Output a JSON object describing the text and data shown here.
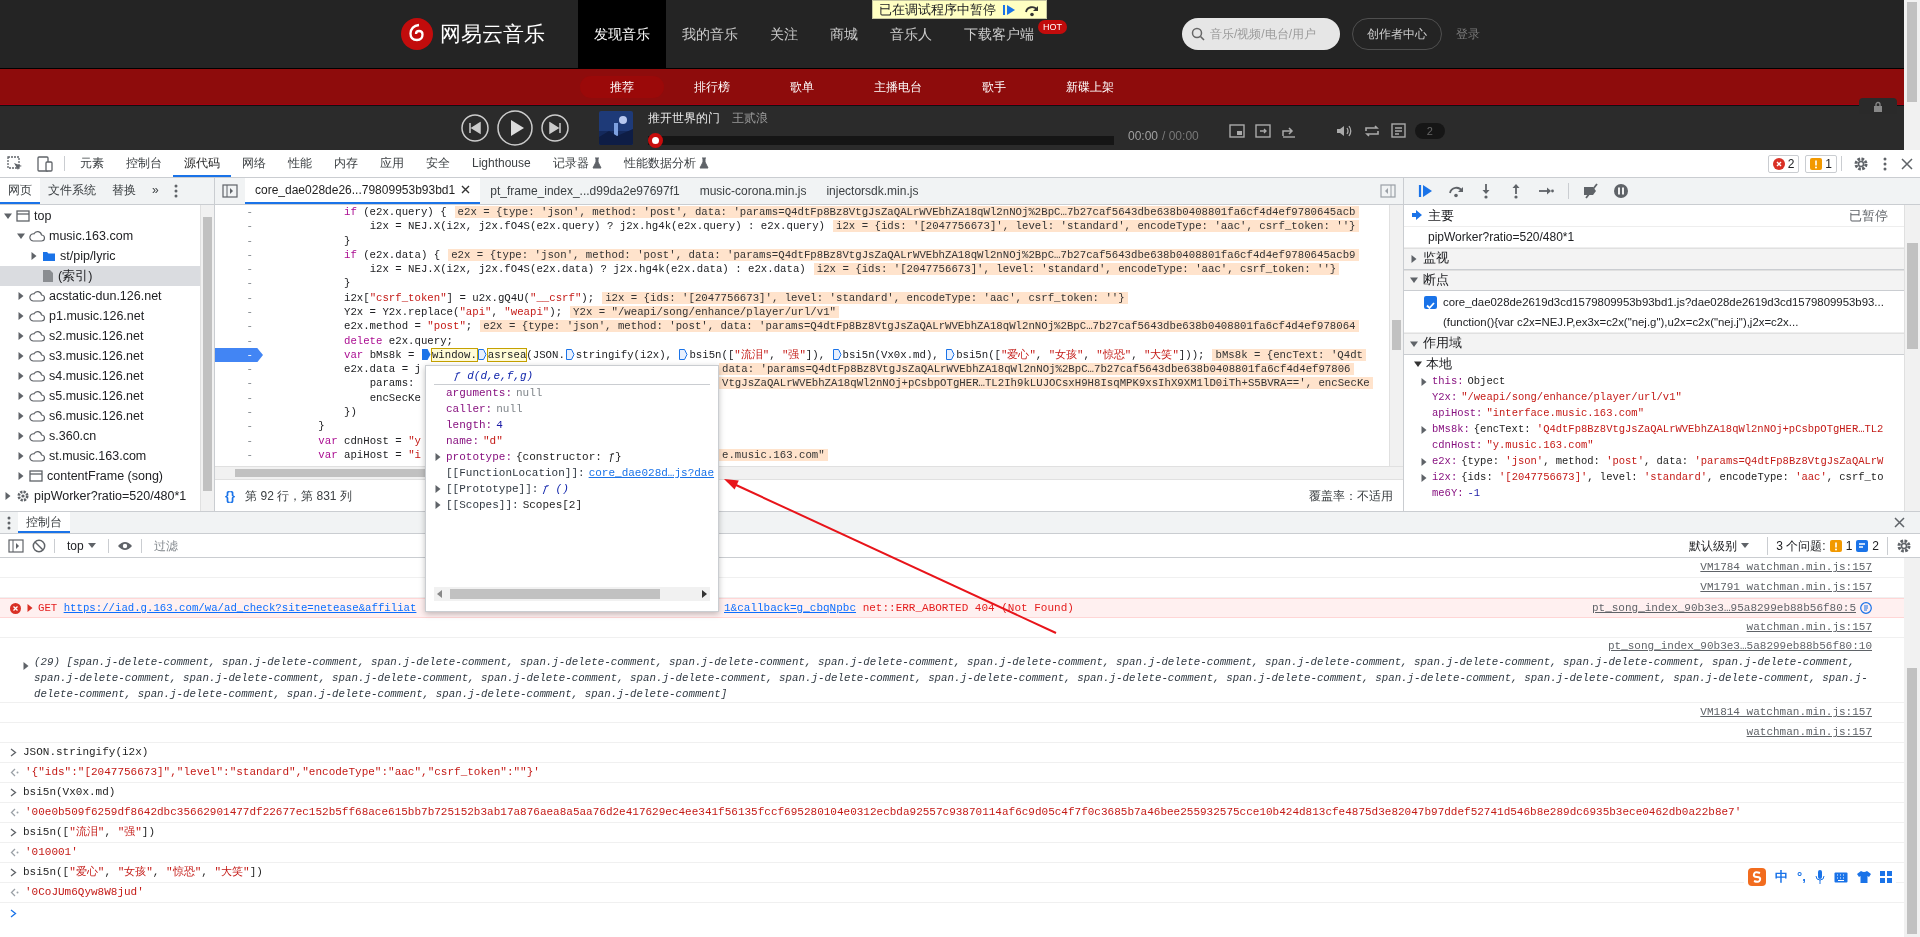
{
  "site": {
    "logo": "网易云音乐",
    "nav": [
      {
        "label": "发现音乐",
        "selected": true
      },
      {
        "label": "我的音乐",
        "selected": false
      },
      {
        "label": "关注",
        "selected": false
      },
      {
        "label": "商城",
        "selected": false
      },
      {
        "label": "音乐人",
        "selected": false
      },
      {
        "label": "下载客户端",
        "selected": false,
        "badge": "HOT"
      }
    ],
    "search": {
      "placeholder": "音乐/视频/电台/用户"
    },
    "creator_button": "创作者中心",
    "login": "登录",
    "subnav": [
      {
        "label": "推荐",
        "selected": true
      },
      {
        "label": "排行榜",
        "selected": false
      },
      {
        "label": "歌单",
        "selected": false
      },
      {
        "label": "主播电台",
        "selected": false
      },
      {
        "label": "歌手",
        "selected": false
      },
      {
        "label": "新碟上架",
        "selected": false
      }
    ],
    "player": {
      "title": "推开世界的门",
      "artist": "王贰浪",
      "level": 0,
      "elapsed": "00:00",
      "duration": "/ 00:00",
      "playlist_count": "2"
    }
  },
  "paused_banner": {
    "text": "已在调试程序中暂停"
  },
  "devtools": {
    "tabs": [
      {
        "label": "元素",
        "selected": false,
        "experimental": false
      },
      {
        "label": "控制台",
        "selected": false,
        "experimental": false
      },
      {
        "label": "源代码",
        "selected": true,
        "experimental": false
      },
      {
        "label": "网络",
        "selected": false,
        "experimental": false
      },
      {
        "label": "性能",
        "selected": false,
        "experimental": false
      },
      {
        "label": "内存",
        "selected": false,
        "experimental": false
      },
      {
        "label": "应用",
        "selected": false,
        "experimental": false
      },
      {
        "label": "安全",
        "selected": false,
        "experimental": false
      },
      {
        "label": "Lighthouse",
        "selected": false,
        "experimental": false
      },
      {
        "label": "记录器",
        "selected": false,
        "experimental": true
      },
      {
        "label": "性能数据分析",
        "selected": false,
        "experimental": true
      }
    ],
    "error_count": "2",
    "warning_count": "1",
    "navigator": {
      "tabs": [
        {
          "label": "网页",
          "selected": true
        },
        {
          "label": "文件系统",
          "selected": false
        },
        {
          "label": "替换",
          "selected": false
        }
      ],
      "more": "»",
      "tree": [
        {
          "label": "top",
          "kind": "frame",
          "expanded": true,
          "selected": false,
          "children": [
            {
              "label": "music.163.com",
              "kind": "domain",
              "expanded": true,
              "selected": false,
              "children": [
                {
                  "label": "st/pip/lyric",
                  "kind": "folder",
                  "expanded": false,
                  "selected": false
                },
                {
                  "label": "(索引)",
                  "kind": "file",
                  "selected": true
                }
              ]
            },
            {
              "label": "acstatic-dun.126.net",
              "kind": "domain",
              "expanded": false,
              "selected": false
            },
            {
              "label": "p1.music.126.net",
              "kind": "domain",
              "expanded": false,
              "selected": false
            },
            {
              "label": "s2.music.126.net",
              "kind": "domain",
              "expanded": false,
              "selected": false
            },
            {
              "label": "s3.music.126.net",
              "kind": "domain",
              "expanded": false,
              "selected": false
            },
            {
              "label": "s4.music.126.net",
              "kind": "domain",
              "expanded": false,
              "selected": false
            },
            {
              "label": "s5.music.126.net",
              "kind": "domain",
              "expanded": false,
              "selected": false
            },
            {
              "label": "s6.music.126.net",
              "kind": "domain",
              "expanded": false,
              "selected": false
            },
            {
              "label": "s.360.cn",
              "kind": "domain",
              "expanded": false,
              "selected": false
            },
            {
              "label": "st.music.163.com",
              "kind": "domain",
              "expanded": false,
              "selected": false
            },
            {
              "label": "contentFrame (song)",
              "kind": "frame",
              "expanded": false,
              "selected": false
            }
          ]
        },
        {
          "label": "pipWorker?ratio=520/480*1",
          "kind": "worker",
          "expanded": false,
          "selected": false
        }
      ]
    },
    "editor": {
      "tabs": [
        {
          "label": "core_dae028de26...79809953b93bd1",
          "selected": true
        },
        {
          "label": "pt_frame_index_...d99da2e97697f1",
          "selected": false
        },
        {
          "label": "music-corona.min.js",
          "selected": false
        },
        {
          "label": "injectorsdk.min.js",
          "selected": false
        }
      ],
      "lines": [
        {
          "gutter": "-",
          "code": "            if (e2x.query) {",
          "value": "e2x = {type: 'json', method: 'post', data: 'params=Q4dtFp8Bz8VtgJsZaQALrWVEbhZA18qWl2nNOj%2BpC…7b27caf5643dbe638b0408801fa6cf4d4ef9780645acb",
          "current": false
        },
        {
          "gutter": "-",
          "code": "                i2x = NEJ.X(i2x, j2x.fO4S(e2x.query) ? j2x.hg4k(e2x.query) : e2x.query)",
          "value": "i2x = {ids: '[2047756673]', level: 'standard', encodeType: 'aac', csrf_token: ''}",
          "current": false
        },
        {
          "gutter": "-",
          "code": "            }",
          "current": false
        },
        {
          "gutter": "-",
          "code": "            if (e2x.data) {",
          "value": "e2x = {type: 'json', method: 'post', data: 'params=Q4dtFp8Bz8VtgJsZaQALrWVEbhZA18qWl2nNOj%2BpC…7b27caf5643dbe638b0408801fa6cf4d4ef9780645acb9",
          "current": false
        },
        {
          "gutter": "-",
          "code": "                i2x = NEJ.X(i2x, j2x.fO4S(e2x.data) ? j2x.hg4k(e2x.data) : e2x.data)",
          "value": "i2x = {ids: '[2047756673]', level: 'standard', encodeType: 'aac', csrf_token: ''}",
          "current": false
        },
        {
          "gutter": "-",
          "code": "            }",
          "current": false
        },
        {
          "gutter": "-",
          "code": "            i2x[\"csrf_token\"] = u2x.gQ4U(\"__csrf\");",
          "value": "i2x = {ids: '[2047756673]', level: 'standard', encodeType: 'aac', csrf_token: ''}",
          "current": false
        },
        {
          "gutter": "-",
          "code": "            Y2x = Y2x.replace(\"api\", \"weapi\");",
          "value": "Y2x = \"/weapi/song/enhance/player/url/v1\"",
          "current": false
        },
        {
          "gutter": "-",
          "code": "            e2x.method = \"post\";",
          "value": "e2x = {type: 'json', method: 'post', data: 'params=Q4dtFp8Bz8VtgJsZaQALrWVEbhZA18qWl2nNOj%2BpC…7b27caf5643dbe638b0408801fa6cf4d4ef978064",
          "current": false
        },
        {
          "gutter": "-",
          "code": "            delete e2x.query;",
          "current": false
        },
        {
          "gutter": "-",
          "segments": [
            {
              "kind": "code",
              "text": "            var bMs8k = ",
              "highlighted": false
            },
            {
              "kind": "stop",
              "current": true
            },
            {
              "kind": "code",
              "text": "window.",
              "highlighted": true
            },
            {
              "kind": "stop",
              "current": false
            },
            {
              "kind": "code",
              "text": "asrsea",
              "highlighted": true
            },
            {
              "kind": "code",
              "text": "(JSON.",
              "highlighted": false
            },
            {
              "kind": "stop",
              "current": false
            },
            {
              "kind": "code",
              "text": "stringify(i2x), ",
              "highlighted": false
            },
            {
              "kind": "stop",
              "current": false
            },
            {
              "kind": "code",
              "text": "bsi5n([\"流泪\", \"强\"]), ",
              "highlighted": false
            },
            {
              "kind": "stop",
              "current": false
            },
            {
              "kind": "code",
              "text": "bsi5n(Vx0x.md), ",
              "highlighted": false
            },
            {
              "kind": "stop",
              "current": false
            },
            {
              "kind": "code",
              "text": "bsi5n([\"爱心\", \"女孩\", \"惊恐\", \"大笑\"]));",
              "highlighted": false
            }
          ],
          "value": "bMs8k = {encText: 'Q4dt",
          "current": true
        },
        {
          "gutter": "-",
          "code": "            e2x.data = j",
          "value_past_popup": "data: 'params=Q4dtFp8Bz8VtgJsZaQALrWVEbhZA18qWl2nNOj%2BpC…7b27caf5643dbe638b0408801fa6cf4d4ef97806",
          "current": false
        },
        {
          "gutter": "-",
          "code": "                params: ",
          "value_past_popup": "VtgJsZaQALrWVEbhZA18qWl2nNOj+pCsbpOTgHER…TL2Ih9kLUJOCsxH9H8IsqMPK9xsIhX9XM1lD0iTh+S5BVRA==', encSecKe",
          "current": false
        },
        {
          "gutter": "-",
          "code": "                encSecKe",
          "current": false
        },
        {
          "gutter": "-",
          "code": "            })",
          "current": false
        },
        {
          "gutter": "-",
          "code": "        }",
          "current": false
        },
        {
          "gutter": "-",
          "code": "        var cdnHost = \"y",
          "current": false
        },
        {
          "gutter": "-",
          "code": "        var apiHost = \"i",
          "value_past_popup": "e.music.163.com\"",
          "current": false
        }
      ],
      "popup": {
        "title": "ƒ d(d,e,f,g)",
        "props": [
          {
            "key": "arguments:",
            "value": "null",
            "kind": "null",
            "internal": false,
            "expandable": false
          },
          {
            "key": "caller:",
            "value": "null",
            "kind": "null",
            "internal": false,
            "expandable": false
          },
          {
            "key": "length:",
            "value": "4",
            "kind": "number",
            "internal": false,
            "expandable": false
          },
          {
            "key": "name:",
            "value": "\"d\"",
            "kind": "string",
            "internal": false,
            "expandable": false
          },
          {
            "key": "prototype:",
            "value": "{constructor: ƒ}",
            "kind": "object",
            "internal": false,
            "expandable": true
          },
          {
            "key": "[[FunctionLocation]]:",
            "value": "core_dae028d…js?dae",
            "kind": "link",
            "internal": true,
            "expandable": false
          },
          {
            "key": "[[Prototype]]:",
            "value": "ƒ ()",
            "kind": "function",
            "internal": true,
            "expandable": true
          },
          {
            "key": "[[Scopes]]:",
            "value": "Scopes[2]",
            "kind": "object",
            "internal": true,
            "expandable": true
          }
        ]
      },
      "format_button": "{}",
      "position": "第 92 行，第 831 列",
      "coverage": "覆盖率：不适用"
    },
    "debugger": {
      "threads": [
        {
          "label": "主要",
          "status": "已暂停",
          "selected": true
        },
        {
          "label": "pipWorker?ratio=520/480*1",
          "selected": false
        }
      ],
      "watch": {
        "title": "监视",
        "expanded": false
      },
      "breakpoints": {
        "title": "断点",
        "expanded": true,
        "items": [
          {
            "checked": true,
            "location": "core_dae028de2619d3cd1579809953b93bd1.js?dae028de2619d3cd1579809953b93...",
            "code": "(function(){var c2x=NEJ.P,ex3x=c2x(\"nej.g\"),u2x=c2x(\"nej.j\"),j2x=c2x..."
          }
        ]
      },
      "scope": {
        "title": "作用域",
        "expanded": true,
        "groups": [
          {
            "title": "本地",
            "expanded": true,
            "variables": [
              {
                "name": "this:",
                "value": "Object",
                "kind": "object",
                "expandable": true
              },
              {
                "name": "Y2x:",
                "value": "\"/weapi/song/enhance/player/url/v1\"",
                "kind": "string",
                "expandable": false
              },
              {
                "name": "apiHost:",
                "value": "\"interface.music.163.com\"",
                "kind": "string",
                "expandable": false
              },
              {
                "name": "bMs8k:",
                "value": "{encText: 'Q4dtFp8Bz8VtgJsZaQALrWVEbhZA18qWl2nNOj+pCsbpOTgHER…TL2",
                "kind": "object",
                "expandable": true
              },
              {
                "name": "cdnHost:",
                "value": "\"y.music.163.com\"",
                "kind": "string",
                "expandable": false
              },
              {
                "name": "e2x:",
                "value": "{type: 'json', method: 'post', data: 'params=Q4dtFp8Bz8VtgJsZaQALrW",
                "kind": "object",
                "expandable": true
              },
              {
                "name": "i2x:",
                "value": "{ids: '[2047756673]', level: 'standard', encodeType: 'aac', csrf_to",
                "kind": "object",
                "expandable": true
              },
              {
                "name": "me6Y:",
                "value": "-1",
                "kind": "number",
                "expandable": false
              }
            ]
          }
        ]
      }
    },
    "console": {
      "tabs": [
        {
          "label": "控制台",
          "selected": true
        }
      ],
      "context": "top",
      "filter_placeholder": "过滤",
      "level": "默认级别",
      "issues_label": "3 个问题:",
      "issue_warnings": "1",
      "issue_infos": "2",
      "messages": [
        {
          "kind": "source",
          "source": "VM1784 watchman.min.js:157"
        },
        {
          "kind": "source",
          "source": "VM1791 watchman.min.js:157"
        },
        {
          "kind": "error",
          "method": "GET",
          "url": "https://iad.g.163.com/wa/ad_check?site=netease&affiliat",
          "url_rest": "1&callback=g_cbqNpbc",
          "message": "net::ERR_ABORTED 404 (Not Found)",
          "source": "pt_song_index_90b3e3…95a8299eb88b56f80:5"
        },
        {
          "kind": "source",
          "source": "watchman.min.js:157"
        },
        {
          "kind": "log",
          "source": "pt_song_index_90b3e3…5a8299eb88b56f80:10",
          "text": "(29) [span.j-delete-comment, span.j-delete-comment, span.j-delete-comment, span.j-delete-comment, span.j-delete-comment, span.j-delete-comment, span.j-delete-comment, span.j-delete-comment, span.j-delete-comment, span.j-delete-comment, span.j-delete-comment, span.j-delete-comment, span.j-delete-comment, span.j-delete-comment, span.j-delete-comment, span.j-delete-comment, span.j-delete-comment, span.j-delete-comment, span.j-delete-comment, span.j-delete-comment, span.j-delete-comment, span.j-delete-comment, span.j-delete-comment, span.j-delete-comment, span.j-delete-comment, span.j-delete-comment, span.j-delete-comment, span.j-delete-comment, span.j-delete-comment]"
        },
        {
          "kind": "source",
          "source": "VM1814 watchman.min.js:157"
        },
        {
          "kind": "source",
          "source": "watchman.min.js:157"
        },
        {
          "kind": "input",
          "text": "JSON.stringify(i2x)"
        },
        {
          "kind": "result",
          "text": "'{\"ids\":\"[2047756673]\",\"level\":\"standard\",\"encodeType\":\"aac\",\"csrf_token\":\"\"}'"
        },
        {
          "kind": "input",
          "text": "bsi5n(Vx0x.md)"
        },
        {
          "kind": "result",
          "text": "'00e0b509f6259df8642dbc35662901477df22677ec152b5ff68ace615bb7b725152b3ab17a876aea8a5aa76d2e417629ec4ee341f56135fccf695280104e0312ecbda92557c93870114af6c9d05c4f7f0c3685b7a46bee255932575cce10b424d813cfe4875d3e82047b97ddef52741d546b8e289dc6935b3ece0462db0a22b8e7'"
        },
        {
          "kind": "input",
          "text": "bsi5n([\"流泪\", \"强\"])"
        },
        {
          "kind": "result",
          "text": "'010001'"
        },
        {
          "kind": "input",
          "text": "bsi5n([\"爱心\", \"女孩\", \"惊恐\", \"大笑\"])"
        },
        {
          "kind": "result",
          "text": "'0CoJUm6Qyw8W8jud'"
        }
      ]
    }
  },
  "ime": {
    "mode": "中",
    "punctuation": "°,"
  }
}
